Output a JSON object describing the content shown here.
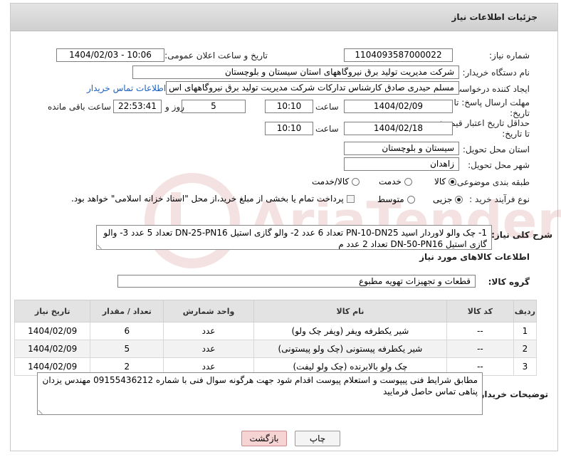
{
  "header": {
    "title": "جزئیات اطلاعات نیاز"
  },
  "fields": {
    "need_number_label": "شماره نیاز:",
    "need_number": "1104093587000022",
    "announce_label": "تاریخ و ساعت اعلان عمومی:",
    "announce_value": "1404/02/03 - 10:06",
    "buyer_org_label": "نام دستگاه خریدار:",
    "buyer_org": "شرکت مدیریت تولید برق نیروگاههای استان سیستان و بلوچستان",
    "requester_label": "ایجاد کننده درخواست:",
    "requester": "مسلم حیدری صادق کارشناس تدارکات شرکت مدیریت تولید برق نیروگاههای اس",
    "contact_link": "اطلاعات تماس خریدار",
    "reply_deadline_label": "مهلت ارسال پاسخ: تا تاریخ:",
    "reply_date": "1404/02/09",
    "time_label": "ساعت",
    "reply_time": "10:10",
    "days_value": "5",
    "days_label": "روز و",
    "remaining_time": "22:53:41",
    "remaining_label": "ساعت باقی مانده",
    "price_validity_label": "حداقل تاریخ اعتبار قیمت: تا تاریخ:",
    "price_date": "1404/02/18",
    "price_time": "10:10",
    "province_label": "استان محل تحویل:",
    "province": "سیستان و بلوچستان",
    "city_label": "شهر محل تحویل:",
    "city": "زاهدان",
    "category_label": "طبقه بندی موضوعی:",
    "category_options": [
      "کالا",
      "خدمت",
      "کالا/خدمت"
    ],
    "process_label": "نوع فرآیند خرید :",
    "process_options": [
      "جزیی",
      "متوسط"
    ],
    "payment_note": "پرداخت تمام یا بخشی از مبلغ خرید،از محل \"اسناد خزانه اسلامی\" خواهد بود."
  },
  "description": {
    "label": "شرح کلی نیاز:",
    "text": "1- چک  والو لاوردار اسید PN-10-DN25 تعداد 6 عدد    2- والو گازی استیل DN-25-PN16 تعداد  5 عدد   3- والو گازی استیل DN-50-PN16 تعداد  2 عدد م"
  },
  "goods_info": {
    "title": "اطلاعات کالاهای مورد نیاز",
    "group_label": "گروه کالا:",
    "group_value": "قطعات و تجهیزات تهویه مطبوع"
  },
  "table": {
    "headers": [
      "ردیف",
      "کد کالا",
      "نام کالا",
      "واحد شمارش",
      "تعداد / مقدار",
      "تاریخ نیاز"
    ],
    "rows": [
      [
        "1",
        "--",
        "شیر یکطرفه ویفر (ویفر چک ولو)",
        "عدد",
        "6",
        "1404/02/09"
      ],
      [
        "2",
        "--",
        "شیر یکطرفه پیستونی (چک ولو پیستونی)",
        "عدد",
        "5",
        "1404/02/09"
      ],
      [
        "3",
        "--",
        "چک ولو بالابرنده (چک ولو لیفت)",
        "عدد",
        "2",
        "1404/02/09"
      ]
    ]
  },
  "buyer_notes": {
    "label": "توضیحات خریدار:",
    "text": "مطابق  شرایط فنی پیپوست  و استعلام پیوست اقدام شود جهت هرگونه سوال فنی با شماره 09155436212 مهندس یزدان پناهی تماس حاصل فرمایید"
  },
  "buttons": {
    "print": "چاپ",
    "back": "بازگشت"
  },
  "colors": {
    "link": "#1a5fc1",
    "back_button_bg": "#f6d4d4",
    "header_bg": "#d9d9d9"
  }
}
